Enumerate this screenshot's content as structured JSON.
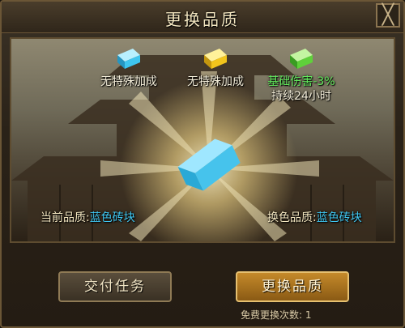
{
  "dialog": {
    "title": "更换品质",
    "close_glyph": "╳"
  },
  "rewards": [
    {
      "label": "无特殊加成",
      "gem_color": "#3ec6f0",
      "icon": "blue-brick-icon"
    },
    {
      "label": "无特殊加成",
      "gem_color": "#f2c51c",
      "icon": "yellow-brick-icon"
    },
    {
      "label": "基础伤害-3%",
      "sublabel": "持续24小时",
      "gem_color": "#5fd13a",
      "icon": "green-brick-icon"
    }
  ],
  "current_quality": {
    "key": "当前品质:",
    "value": "蓝色砖块"
  },
  "new_quality": {
    "key": "换色品质:",
    "value": "蓝色砖块"
  },
  "buttons": {
    "submit_task": "交付任务",
    "change_quality": "更换品质"
  },
  "free_changes": "免费更换次数: 1",
  "colors": {
    "accent_blue": "#3fc7f2",
    "accent_green": "#62e85c",
    "gold": "#c58a2a"
  }
}
